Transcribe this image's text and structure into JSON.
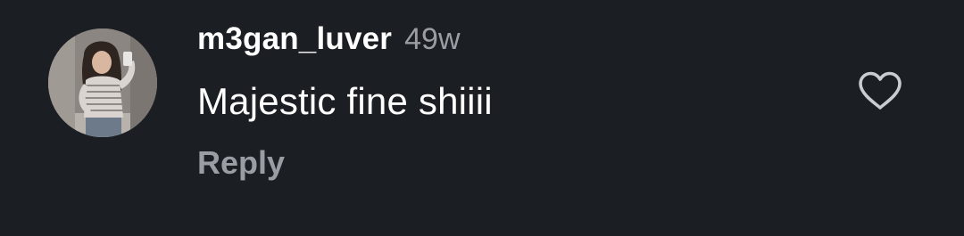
{
  "comment": {
    "username": "m3gan_luver",
    "timestamp": "49w",
    "text": "Majestic fine shiiii",
    "reply_label": "Reply",
    "liked": false
  },
  "icons": {
    "avatar": "user-photo-avatar",
    "like": "heart-outline-icon"
  },
  "colors": {
    "background": "#1b1e22",
    "primary_text": "#ffffff",
    "secondary_text": "#9a9da3",
    "icon_stroke": "#c9ccd1"
  }
}
